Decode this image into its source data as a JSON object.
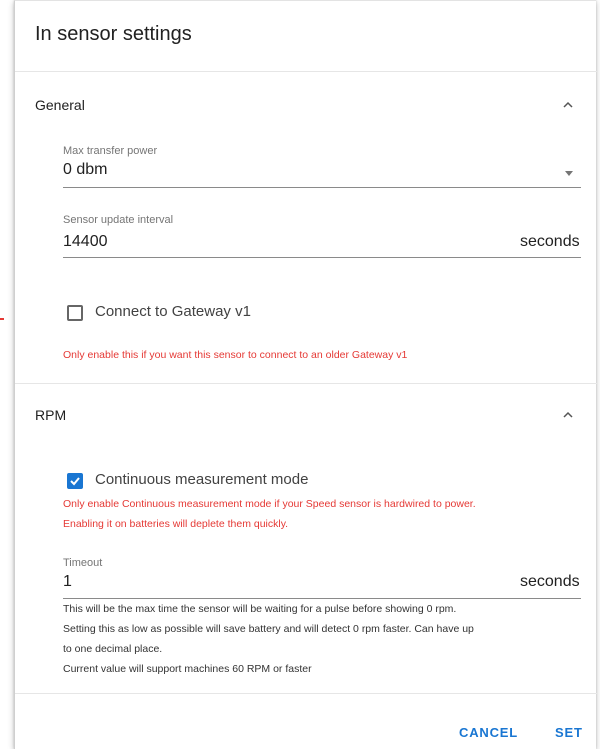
{
  "dialog": {
    "title": "In sensor settings"
  },
  "general": {
    "header": "General",
    "max_power": {
      "label": "Max transfer power",
      "value": "0 dbm"
    },
    "update_interval": {
      "label": "Sensor update interval",
      "value": "14400",
      "suffix": "seconds"
    },
    "gateway_checkbox": {
      "label": "Connect to Gateway v1",
      "checked": false
    },
    "gateway_warning": "Only enable this if you want this sensor to connect to an older Gateway v1"
  },
  "rpm": {
    "header": "RPM",
    "continuous_checkbox": {
      "label": "Continuous measurement mode",
      "checked": true
    },
    "continuous_warning_line1": "Only enable Continuous measurement mode if your Speed sensor is hardwired to power.",
    "continuous_warning_line2": "Enabling it on batteries will deplete them quickly.",
    "timeout": {
      "label": "Timeout",
      "value": "1",
      "suffix": "seconds"
    },
    "help_line1": "This will be the max time the sensor will be waiting for a pulse before showing 0 rpm.",
    "help_line2": "Setting this as low as possible will save battery and will detect 0 rpm faster. Can have up",
    "help_line3": "to one decimal place.",
    "help_line4": "Current value will support machines 60 RPM or faster"
  },
  "actions": {
    "cancel": "CANCEL",
    "set": "SET"
  },
  "colors": {
    "accent": "#1976d2",
    "warning": "#e53935"
  },
  "icons": {
    "collapse": "chevron-up-icon",
    "dropdown": "dropdown-arrow-icon",
    "checkmark": "check-icon"
  }
}
